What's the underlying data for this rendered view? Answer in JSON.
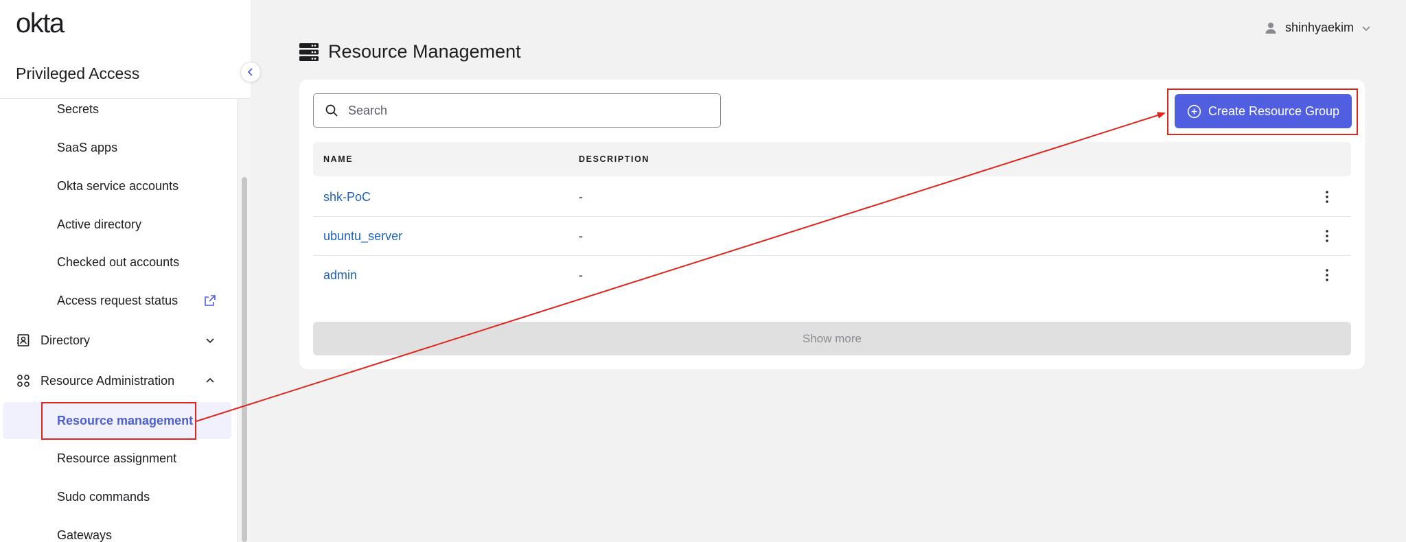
{
  "sidebar": {
    "logo": "okta",
    "app_title": "Privileged Access",
    "items": [
      {
        "label": "Secrets",
        "icon": ""
      },
      {
        "label": "SaaS apps",
        "icon": ""
      },
      {
        "label": "Okta service accounts",
        "icon": ""
      },
      {
        "label": "Active directory",
        "icon": ""
      },
      {
        "label": "Checked out accounts",
        "icon": ""
      },
      {
        "label": "Access request status",
        "icon": "external-link-icon"
      }
    ],
    "sections": [
      {
        "label": "Directory",
        "icon": "directory-icon",
        "expanded": false
      },
      {
        "label": "Resource Administration",
        "icon": "grid-icon",
        "expanded": true
      }
    ],
    "admin_items": [
      {
        "label": "Resource management",
        "active": true
      },
      {
        "label": "Resource assignment",
        "active": false
      },
      {
        "label": "Sudo commands",
        "active": false
      },
      {
        "label": "Gateways",
        "active": false
      }
    ]
  },
  "header": {
    "username": "shinhyaekim"
  },
  "main": {
    "page_title": "Resource Management",
    "search_placeholder": "Search",
    "create_button": "Create Resource Group",
    "columns": [
      "NAME",
      "DESCRIPTION"
    ],
    "rows": [
      {
        "name": "shk-PoC",
        "description": "-"
      },
      {
        "name": "ubuntu_server",
        "description": "-"
      },
      {
        "name": "admin",
        "description": "-"
      }
    ],
    "show_more": "Show more"
  },
  "colors": {
    "accent": "#4f5fe0",
    "link": "#1f62bb",
    "annotation": "#e0251b",
    "active_bg": "#f1f1fd"
  }
}
